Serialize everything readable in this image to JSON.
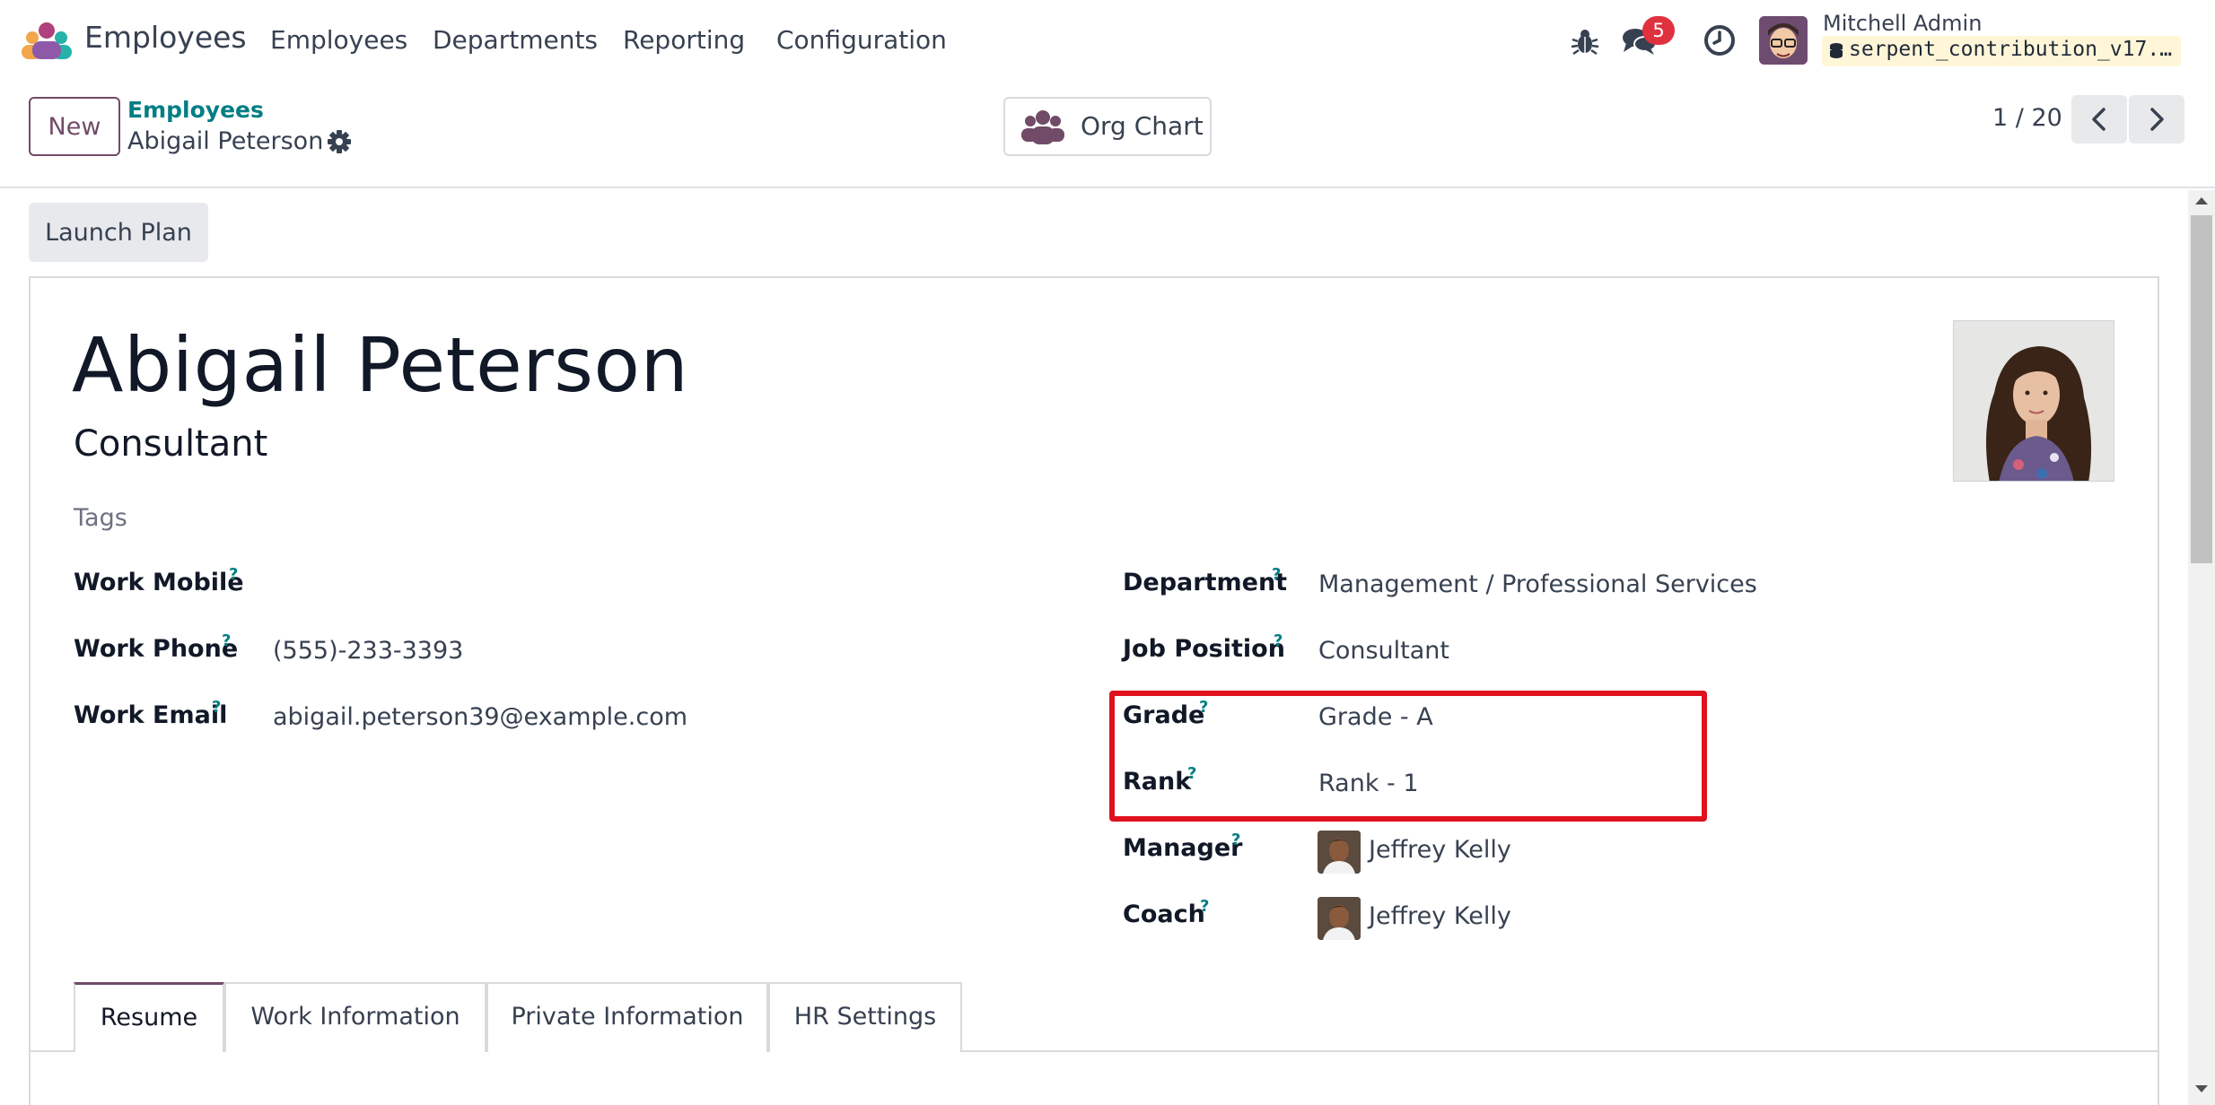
{
  "topnav": {
    "app_name": "Employees",
    "menus": [
      "Employees",
      "Departments",
      "Reporting",
      "Configuration"
    ],
    "chat_count": "5",
    "user_name": "Mitchell Admin",
    "database": "serpent_contribution_v17..."
  },
  "control_panel": {
    "new_label": "New",
    "breadcrumb_parent": "Employees",
    "breadcrumb_current": "Abigail Peterson",
    "org_chart_label": "Org Chart",
    "pager": "1 / 20"
  },
  "statusbar": {
    "launch_plan_label": "Launch Plan"
  },
  "employee": {
    "name": "Abigail Peterson",
    "job_title": "Consultant",
    "tags_placeholder": "Tags"
  },
  "fields_left": {
    "work_mobile": {
      "label": "Work Mobile",
      "value": ""
    },
    "work_phone": {
      "label": "Work Phone",
      "value": "(555)-233-3393"
    },
    "work_email": {
      "label": "Work Email",
      "value": "abigail.peterson39@example.com"
    }
  },
  "fields_right": {
    "department": {
      "label": "Department",
      "value": "Management / Professional Services"
    },
    "job_position": {
      "label": "Job Position",
      "value": "Consultant"
    },
    "grade": {
      "label": "Grade",
      "value": "Grade - A"
    },
    "rank": {
      "label": "Rank",
      "value": "Rank - 1"
    },
    "manager": {
      "label": "Manager",
      "value": "Jeffrey Kelly"
    },
    "coach": {
      "label": "Coach",
      "value": "Jeffrey Kelly"
    }
  },
  "help_mark": "?",
  "tabs": [
    "Resume",
    "Work Information",
    "Private Information",
    "HR Settings"
  ],
  "colors": {
    "brand": "#714b67",
    "link": "#017e84",
    "badge": "#e0313f",
    "highlight": "#e0121e"
  }
}
